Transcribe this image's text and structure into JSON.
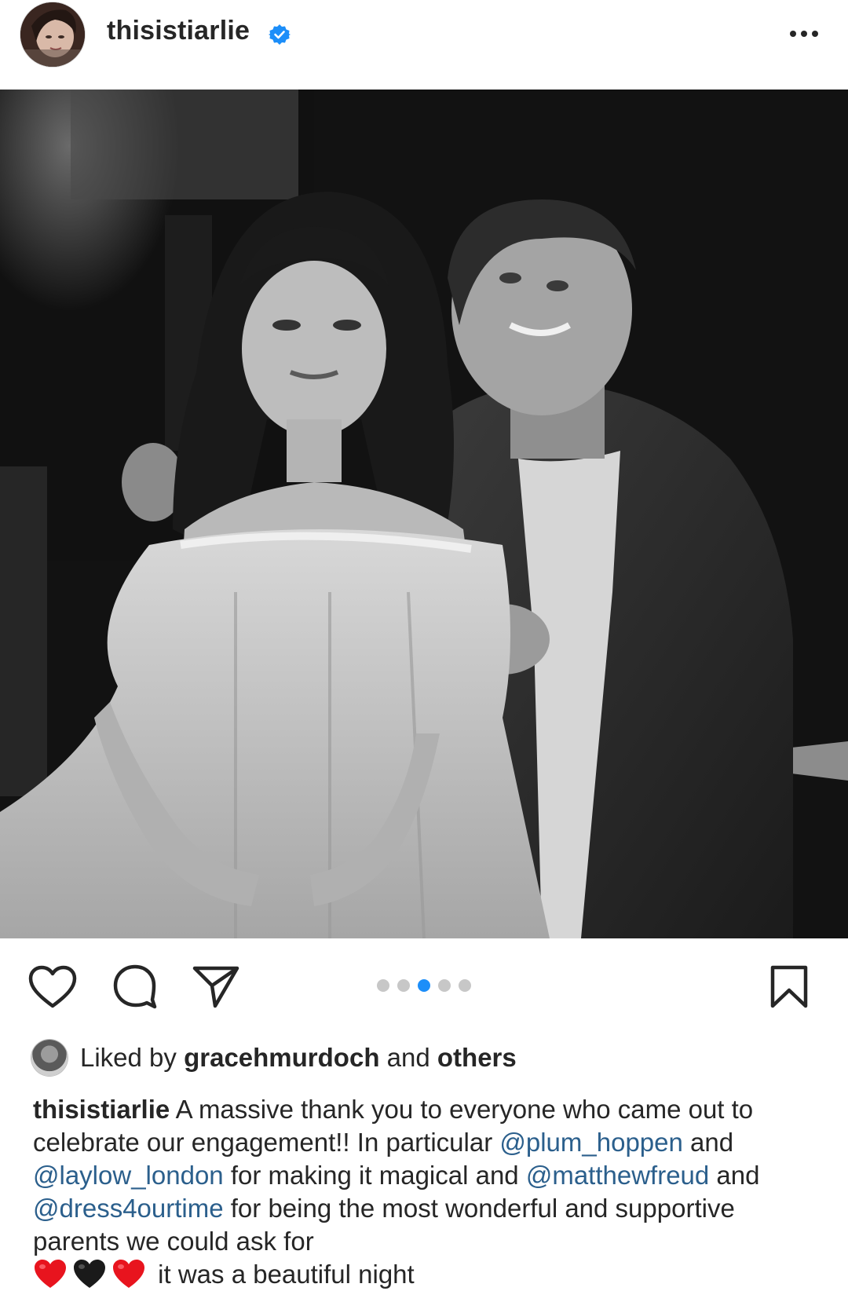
{
  "post": {
    "username": "thisistiarlie",
    "verified": true,
    "more_icon": "more-horizontal-icon"
  },
  "carousel": {
    "total": 5,
    "active_index": 2
  },
  "actions": {
    "like_icon": "heart-outline-icon",
    "comment_icon": "comment-bubble-icon",
    "share_icon": "paper-plane-icon",
    "save_icon": "bookmark-icon"
  },
  "likes": {
    "prefix": "Liked by ",
    "user": "gracehmurdoch",
    "middle": " and ",
    "others": "others"
  },
  "caption": {
    "username": "thisistiarlie",
    "text1": " A massive thank you to everyone who came out to celebrate our engagement!! In particular ",
    "mention1": "@plum_hoppen",
    "text2": " and ",
    "mention2": "@laylow_london",
    "text3": " for making it magical and ",
    "mention3": "@matthewfreud",
    "text4": " and ",
    "mention4": "@dress4ourtime",
    "text5": " for being the most wonderful and supportive parents we could ask for ",
    "emojis": [
      "red-heart",
      "black-heart",
      "red-heart"
    ],
    "text6": " it was a beautiful night"
  },
  "colors": {
    "text": "#262626",
    "mention": "#2b5f8c",
    "verified": "#1c8ef9",
    "dot_active": "#1c8ef9",
    "dot_inactive": "#c7c7c7",
    "red_heart": "#e8141e",
    "black_heart": "#1a1a1a"
  }
}
